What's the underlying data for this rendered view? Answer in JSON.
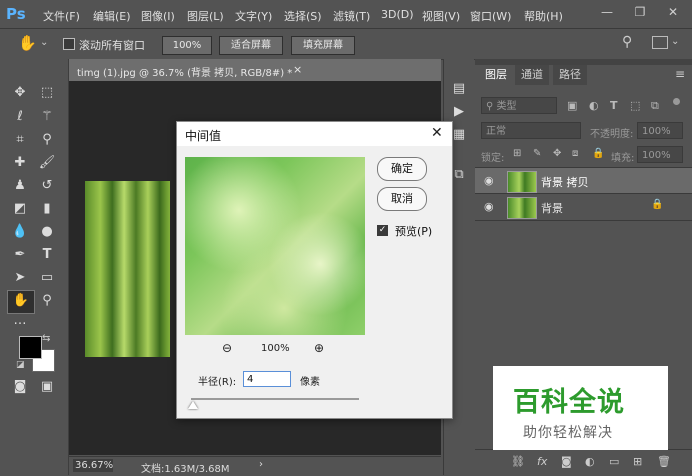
{
  "app": {
    "logo": "Ps"
  },
  "menu": [
    "文件(F)",
    "编辑(E)",
    "图像(I)",
    "图层(L)",
    "文字(Y)",
    "选择(S)",
    "滤镜(T)",
    "3D(D)",
    "视图(V)",
    "窗口(W)",
    "帮助(H)"
  ],
  "options_bar": {
    "scroll_all_label": "滚动所有窗口",
    "zoom_value": "100%",
    "fit_screen": "适合屏幕",
    "fill_screen": "填充屏幕"
  },
  "document": {
    "tab_title": "timg (1).jpg @ 36.7% (背景 拷贝, RGB/8#) *",
    "close_glyph": "×",
    "zoom_status": "36.67%",
    "doc_info": "文档:1.63M/3.68M"
  },
  "layers_panel": {
    "tabs": [
      "图层",
      "通道",
      "路径"
    ],
    "filter_kind": "类型",
    "blend_mode": "正常",
    "opacity_label": "不透明度:",
    "opacity_value": "100%",
    "lock_label": "锁定:",
    "fill_label": "填充:",
    "fill_value": "100%",
    "layers": [
      {
        "name": "背景 拷贝",
        "selected": true,
        "locked": false
      },
      {
        "name": "背景",
        "selected": false,
        "locked": true
      }
    ]
  },
  "dialog": {
    "title": "中间值",
    "ok": "确定",
    "cancel": "取消",
    "preview_label": "预览(P)",
    "preview_checked": true,
    "zoom_level": "100%",
    "radius_label": "半径(R):",
    "radius_value": "4",
    "unit": "像素"
  },
  "watermark": {
    "title": "百科全说",
    "subtitle": "助你轻松解决"
  },
  "colors": {
    "foreground": "#000000",
    "background": "#ffffff",
    "accent": "#5ab4ff",
    "watermark_green": "#2d9b2d"
  }
}
